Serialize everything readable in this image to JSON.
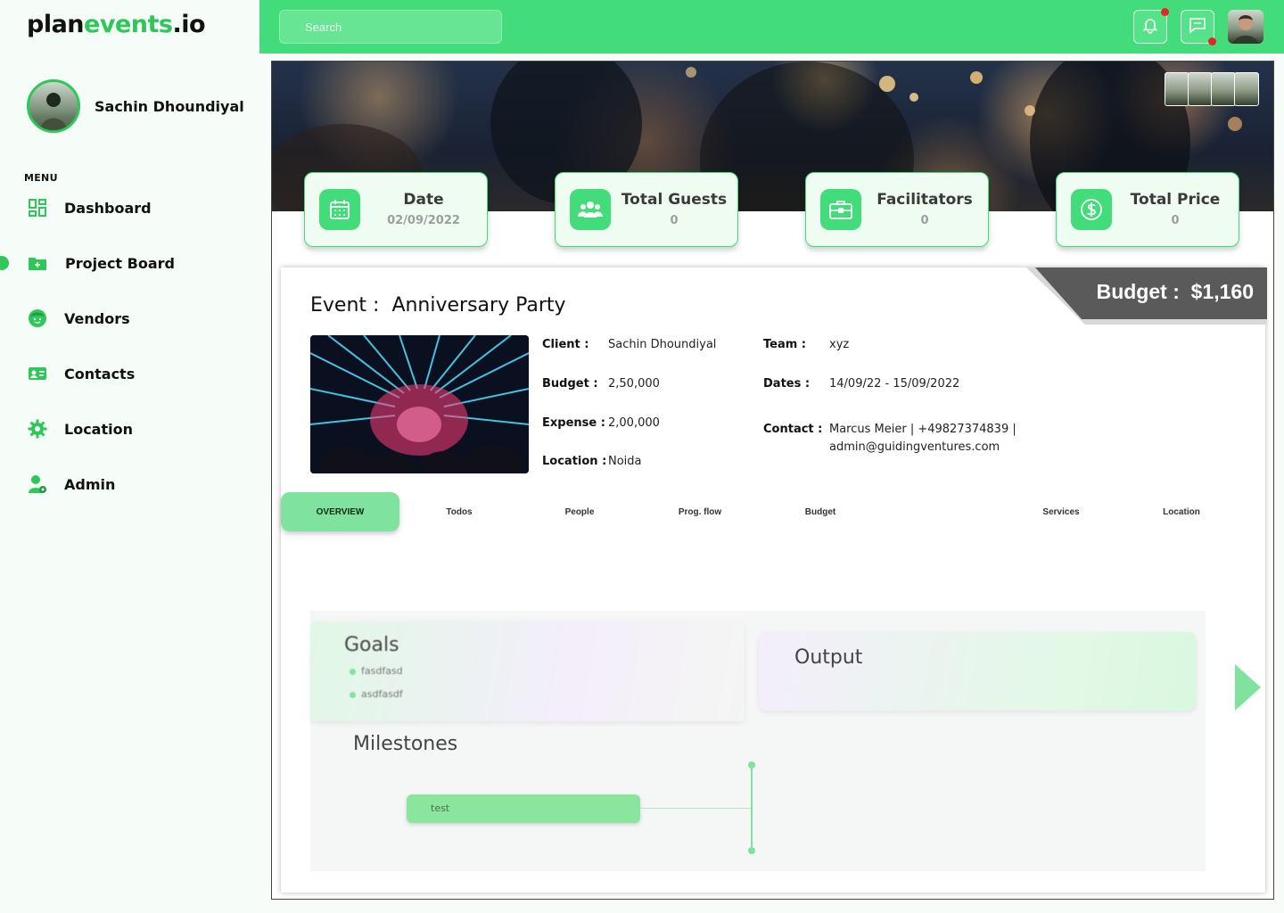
{
  "brand": {
    "prefix": "plan",
    "accent": "events",
    "suffix": ".io"
  },
  "profile": {
    "name": "Sachin Dhoundiyal"
  },
  "menu": {
    "label": "MENU",
    "items": [
      {
        "label": "Dashboard",
        "icon": "dashboard-icon"
      },
      {
        "label": "Project Board",
        "icon": "folder-plus-icon",
        "active": true
      },
      {
        "label": "Vendors",
        "icon": "face-icon"
      },
      {
        "label": "Contacts",
        "icon": "contact-card-icon"
      },
      {
        "label": "Location",
        "icon": "gear-icon"
      },
      {
        "label": "Admin",
        "icon": "user-admin-icon"
      }
    ]
  },
  "topbar": {
    "search_placeholder": "Search",
    "notification_icon": "bell-icon",
    "message_icon": "chat-icon"
  },
  "stats": [
    {
      "title": "Date",
      "value": "02/09/2022",
      "icon": "calendar-icon"
    },
    {
      "title": "Total Guests",
      "value": "0",
      "icon": "people-icon"
    },
    {
      "title": "Facilitators",
      "value": "0",
      "icon": "briefcase-icon"
    },
    {
      "title": "Total Price",
      "value": "0",
      "icon": "dollar-icon"
    }
  ],
  "budget_banner": {
    "label": "Budget :",
    "amount": "$1,160"
  },
  "event": {
    "prefix": "Event :",
    "name": "Anniversary Party",
    "client_label": "Client :",
    "client": "Sachin Dhoundiyal",
    "budget_label": "Budget :",
    "budget": "2,50,000",
    "expense_label": "Expense :",
    "expense": "2,00,000",
    "location_label": "Location :",
    "location": "Noida",
    "team_label": "Team :",
    "team": "xyz",
    "dates_label": "Dates :",
    "dates": "14/09/22 - 15/09/2022",
    "contact_label": "Contact :",
    "contact_line1": "Marcus Meier | +49827374839 |",
    "contact_line2": "admin@guidingventures.com"
  },
  "tabs": [
    "OVERVIEW",
    "Todos",
    "People",
    "Prog. flow",
    "Budget",
    "Services",
    "Location"
  ],
  "overview": {
    "goals_title": "Goals",
    "goals": [
      "fasdfasd",
      "asdfasdf"
    ],
    "output_title": "Output",
    "milestones_title": "Milestones",
    "milestone": "test"
  },
  "colors": {
    "accent": "#42dd7a",
    "accent_light": "#7fe39f",
    "banner": "#5a5a5a"
  }
}
